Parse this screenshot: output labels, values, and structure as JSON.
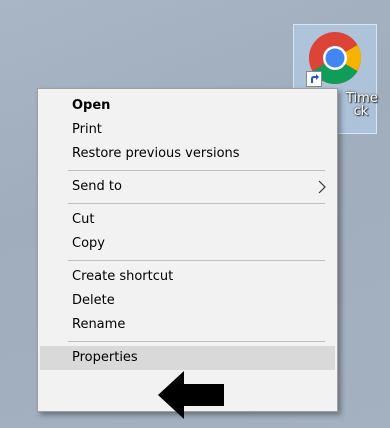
{
  "desktop": {
    "shortcut": {
      "icon": "chrome-icon",
      "overlay_icon": "shortcut-arrow-icon",
      "label": "Time\nck"
    }
  },
  "context_menu": {
    "groups": [
      {
        "items": [
          {
            "label": "Open",
            "bold": true
          },
          {
            "label": "Print"
          },
          {
            "label": "Restore previous versions"
          }
        ]
      },
      {
        "items": [
          {
            "label": "Send to",
            "submenu": true
          }
        ]
      },
      {
        "items": [
          {
            "label": "Cut"
          },
          {
            "label": "Copy"
          }
        ]
      },
      {
        "items": [
          {
            "label": "Create shortcut"
          },
          {
            "label": "Delete"
          },
          {
            "label": "Rename"
          }
        ]
      },
      {
        "items": [
          {
            "label": "Properties",
            "highlighted": true
          }
        ]
      }
    ]
  },
  "annotation": {
    "icon": "black-left-arrow-icon",
    "color": "#000000"
  },
  "colors": {
    "menu_background": "#f2f2f2",
    "highlight": "#d9d9d9",
    "separator": "#bdbdbd"
  }
}
